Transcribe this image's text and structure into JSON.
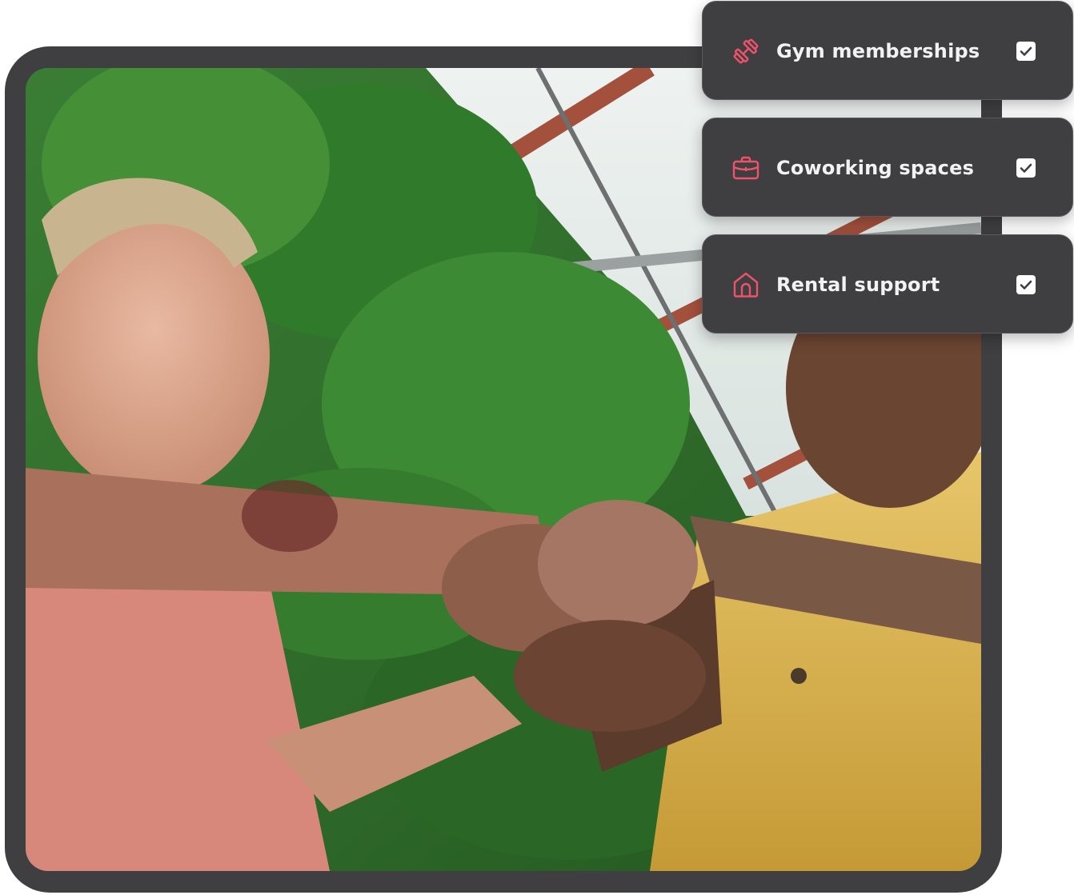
{
  "benefits": [
    {
      "label": "Gym memberships",
      "icon": "dumbbell-icon",
      "checked": true
    },
    {
      "label": "Coworking spaces",
      "icon": "briefcase-icon",
      "checked": true
    },
    {
      "label": "Rental support",
      "icon": "home-icon",
      "checked": true
    }
  ],
  "colors": {
    "frame": "#3f3f41",
    "card_background": "#3f3f41",
    "icon_accent": "#f0526a",
    "label_text": "#f2f2f2",
    "checkbox_fill": "#ffffff"
  },
  "photo": {
    "icon": "photo-illustration",
    "subject": "people fist-bumping among plants"
  }
}
